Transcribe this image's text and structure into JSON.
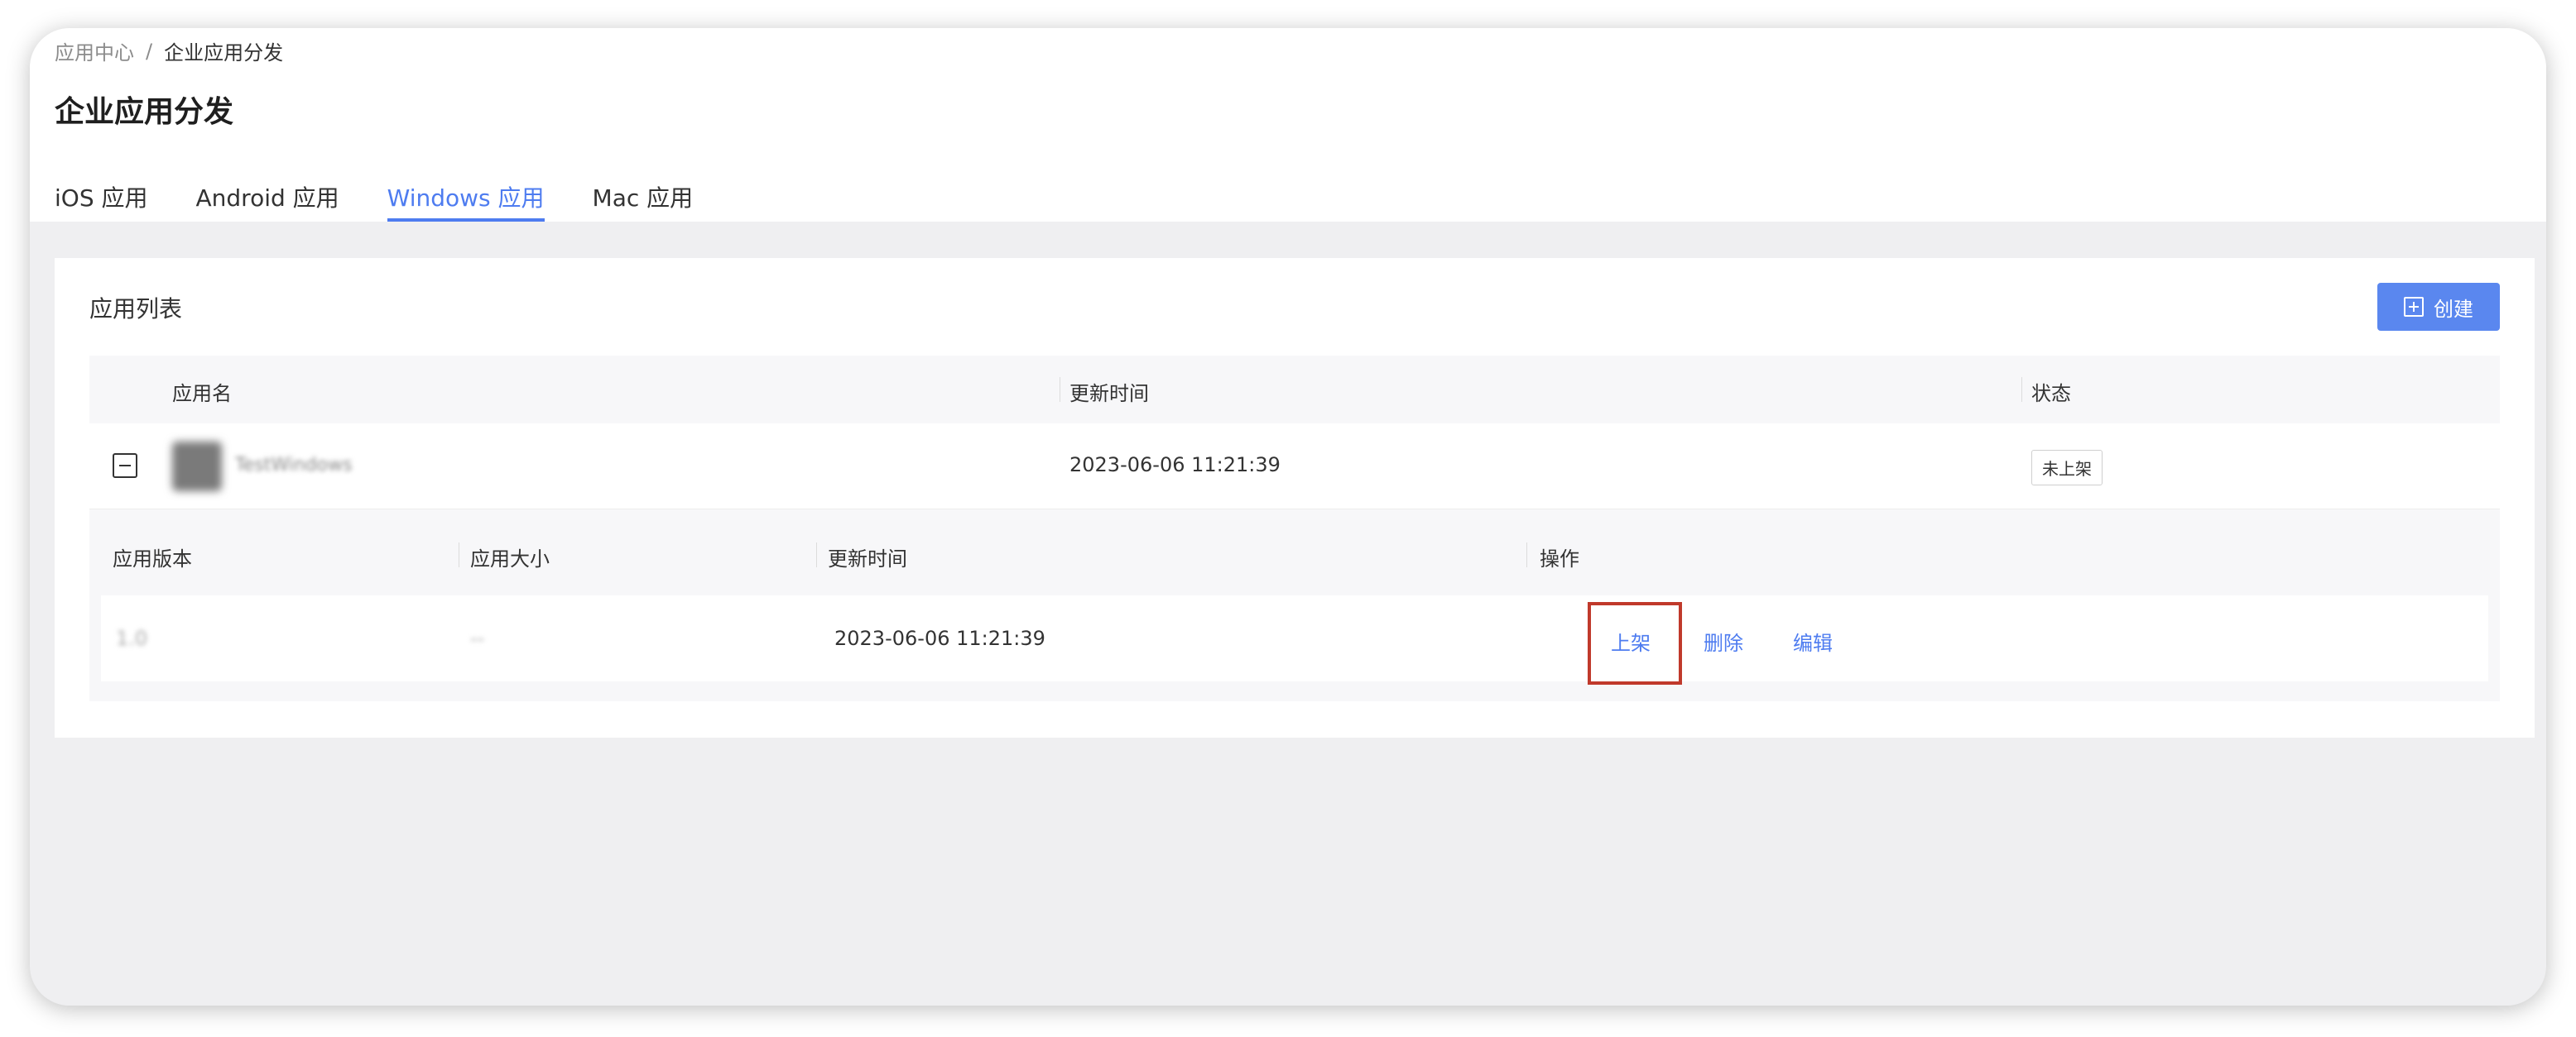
{
  "breadcrumb": {
    "parent": "应用中心",
    "separator": "/",
    "current": "企业应用分发"
  },
  "page": {
    "title": "企业应用分发"
  },
  "tabs": [
    {
      "label": "iOS 应用",
      "active": false
    },
    {
      "label": "Android 应用",
      "active": false
    },
    {
      "label": "Windows 应用",
      "active": true
    },
    {
      "label": "Mac 应用",
      "active": false
    }
  ],
  "panel": {
    "title": "应用列表",
    "create_label": "创建",
    "create_icon": "plus-square-icon"
  },
  "table": {
    "columns": [
      "应用名",
      "更新时间",
      "状态"
    ],
    "rows": [
      {
        "name": "TestWindows",
        "updated": "2023-06-06 11:21:39",
        "status": "未上架"
      }
    ]
  },
  "subtable": {
    "columns": [
      "应用版本",
      "应用大小",
      "更新时间",
      "操作"
    ],
    "rows": [
      {
        "version": "1.0",
        "size": "--",
        "updated": "2023-06-06 11:21:39",
        "actions": [
          "上架",
          "删除",
          "编辑"
        ]
      }
    ]
  },
  "colors": {
    "accent": "#4e7cf0",
    "button": "#5a87ef",
    "highlight": "#c0392b",
    "background": "#efeff1"
  }
}
